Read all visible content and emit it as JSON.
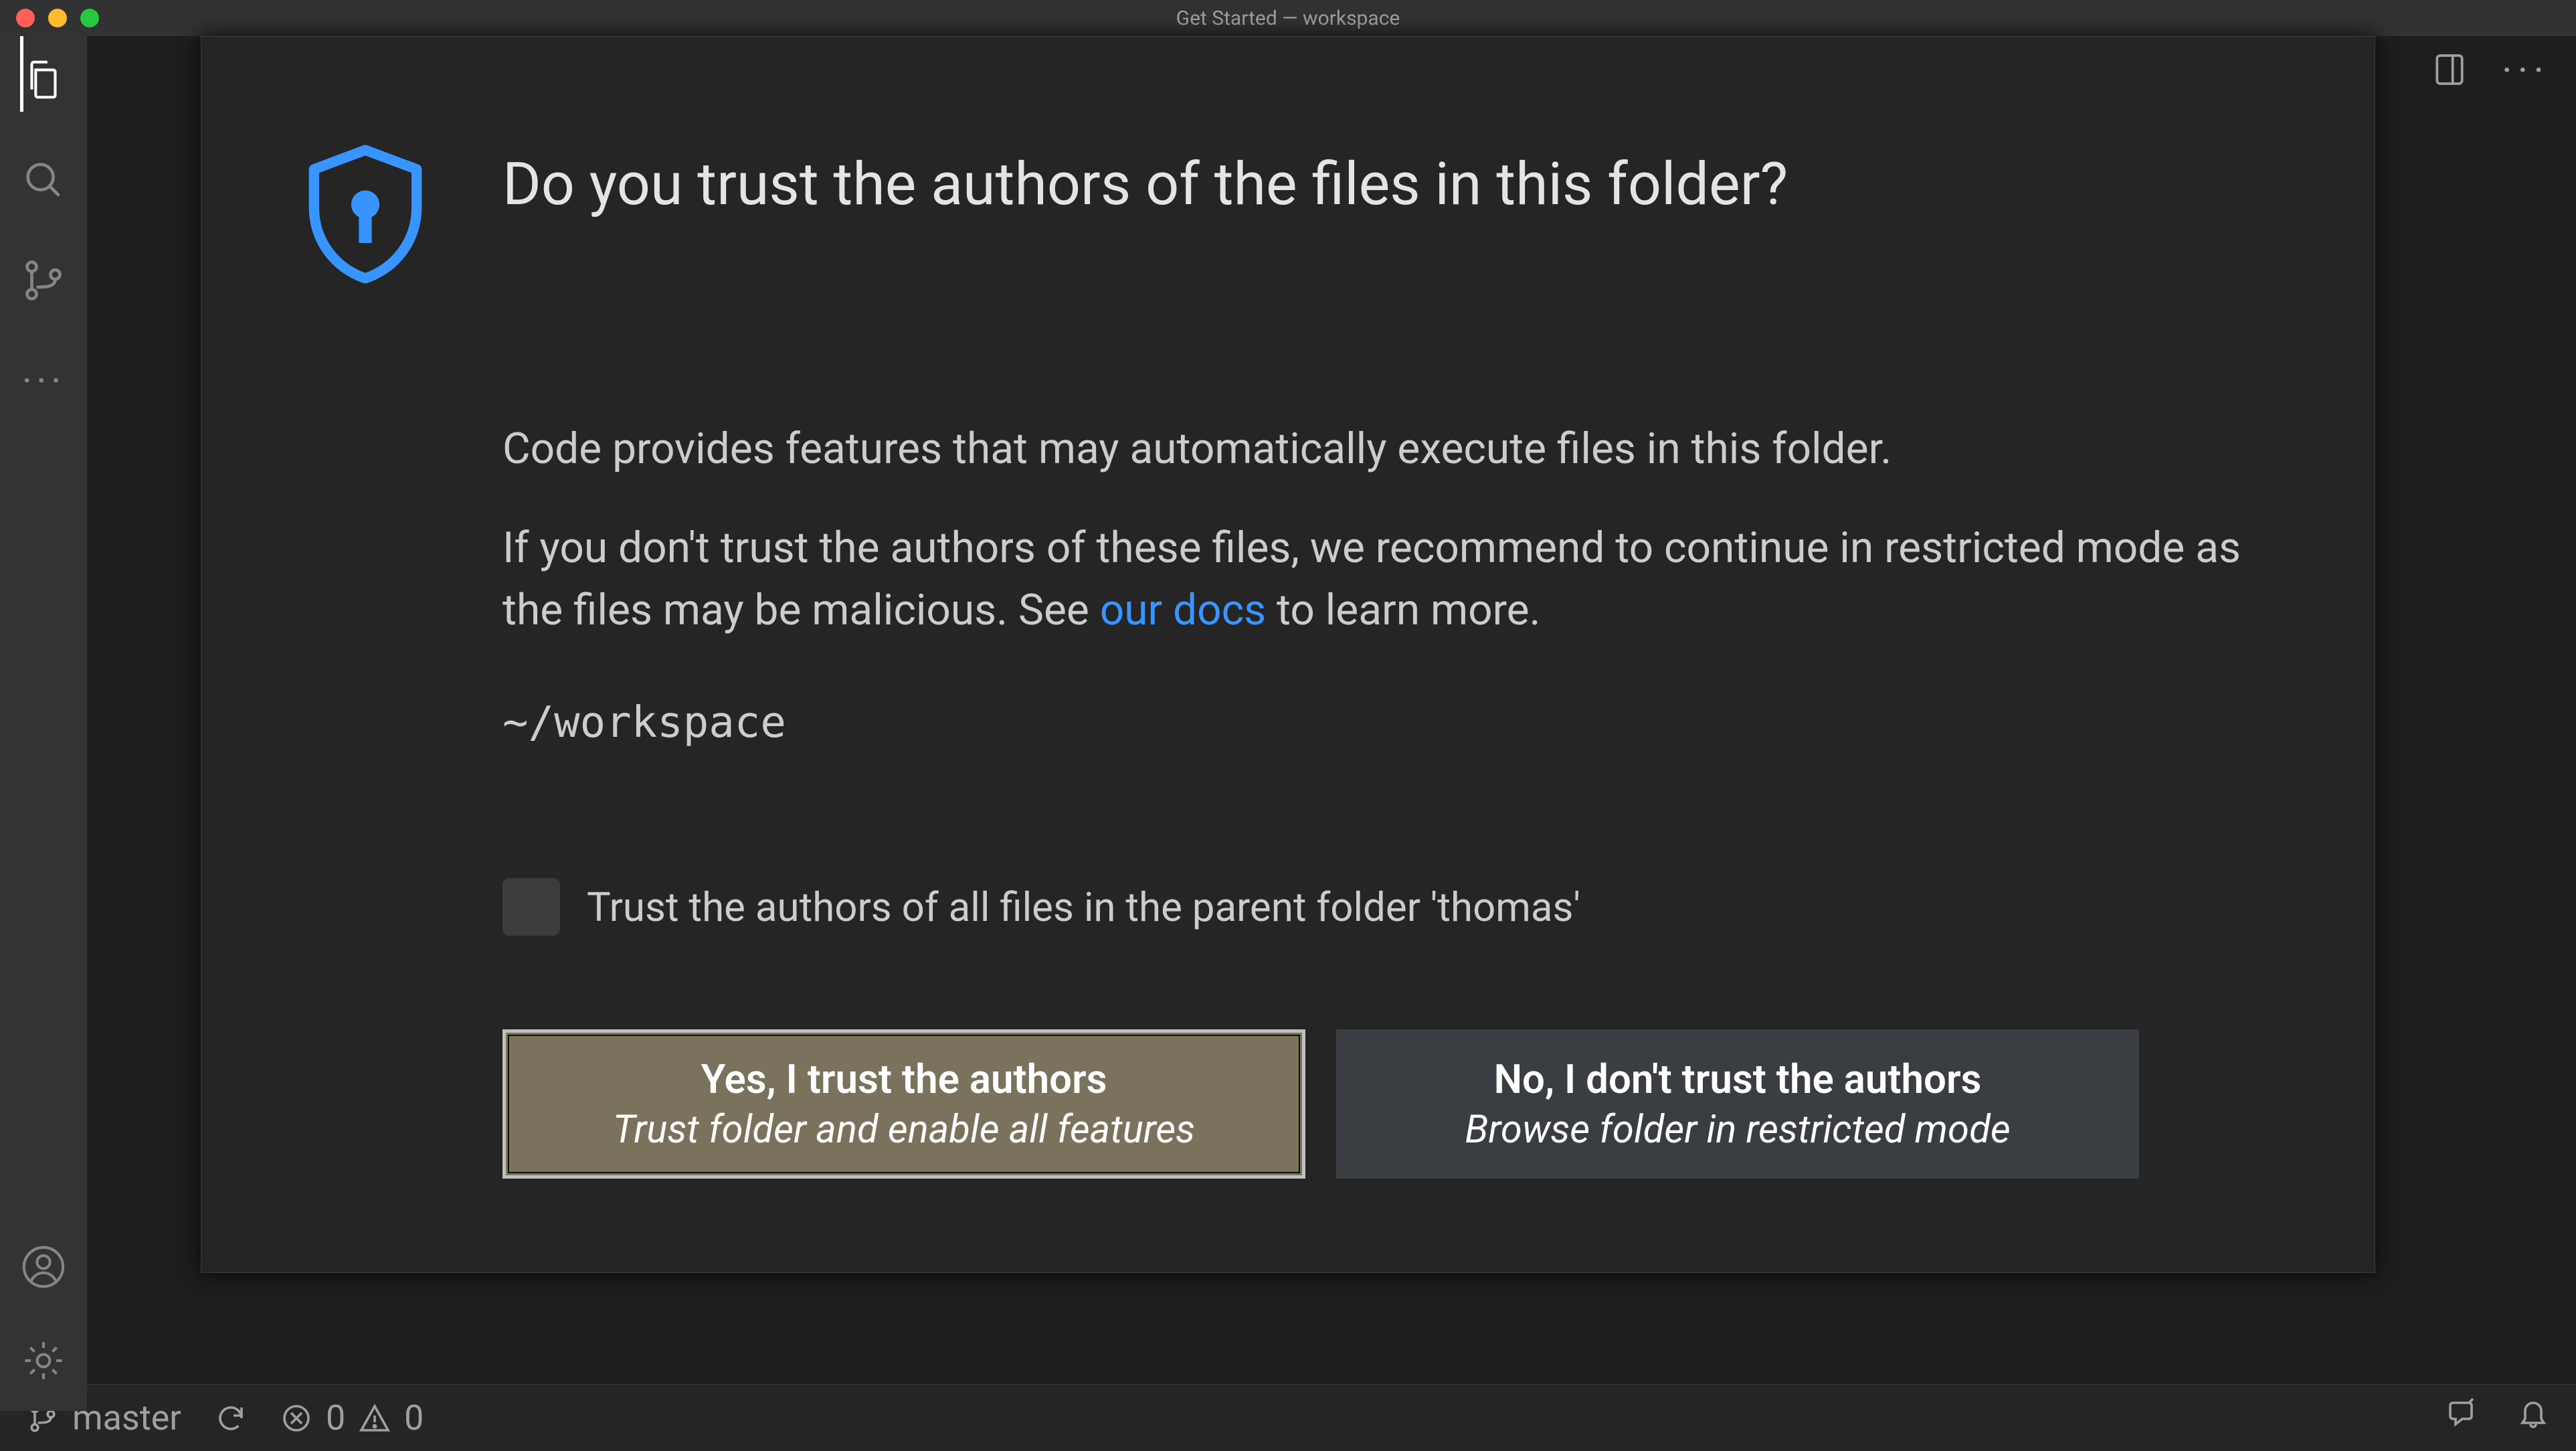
{
  "titlebar": {
    "title": "Get Started — workspace"
  },
  "dialog": {
    "heading": "Do you trust the authors of the files in this folder?",
    "paragraph1": "Code provides features that may automatically execute files in this folder.",
    "paragraph2_a": "If you don't trust the authors of these files, we recommend to continue in restricted mode as the files may be malicious. See ",
    "paragraph2_link": "our docs",
    "paragraph2_b": " to learn more.",
    "path": "~/workspace",
    "checkbox_label": "Trust the authors of all files in the parent folder 'thomas'",
    "btn_yes_title": "Yes, I trust the authors",
    "btn_yes_sub": "Trust folder and enable all features",
    "btn_no_title": "No, I don't trust the authors",
    "btn_no_sub": "Browse folder in restricted mode"
  },
  "statusbar": {
    "branch": "master",
    "errors": "0",
    "warnings": "0"
  }
}
